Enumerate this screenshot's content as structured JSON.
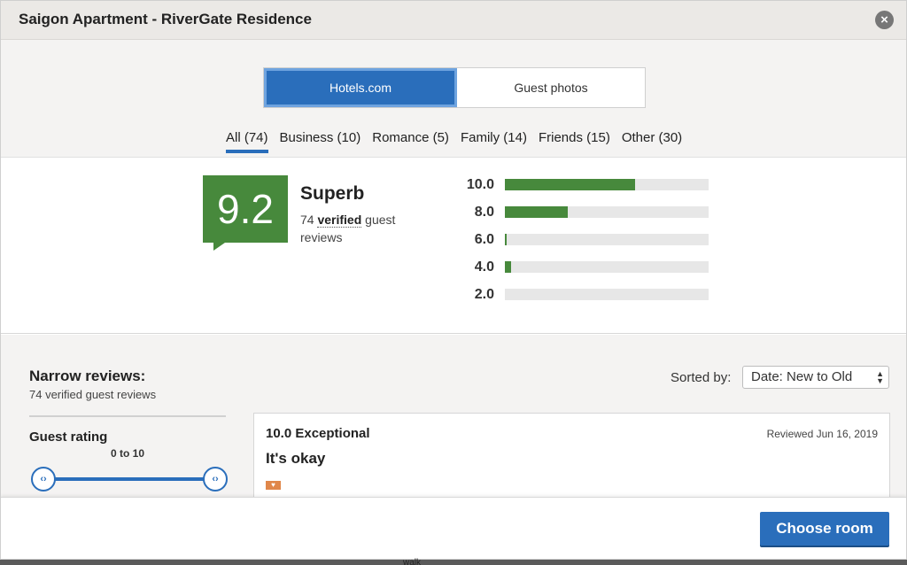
{
  "window": {
    "title": "Saigon Apartment - RiverGate Residence",
    "close_icon": "close-icon"
  },
  "source_toggle": [
    {
      "label": "Hotels.com",
      "active": true
    },
    {
      "label": "Guest photos",
      "active": false
    }
  ],
  "filter_tabs": [
    {
      "label": "All (74)",
      "active": true
    },
    {
      "label": "Business (10)",
      "active": false
    },
    {
      "label": "Romance (5)",
      "active": false
    },
    {
      "label": "Family (14)",
      "active": false
    },
    {
      "label": "Friends (15)",
      "active": false
    },
    {
      "label": "Other (30)",
      "active": false
    }
  ],
  "summary": {
    "score": "9.2",
    "rating_word": "Superb",
    "count_prefix": "74",
    "verified_word": "verified",
    "count_suffix": "guest reviews",
    "score_color": "#47893c"
  },
  "distribution": [
    {
      "label": "10.0",
      "fraction": 0.64
    },
    {
      "label": "8.0",
      "fraction": 0.31
    },
    {
      "label": "6.0",
      "fraction": 0.01
    },
    {
      "label": "4.0",
      "fraction": 0.03
    },
    {
      "label": "2.0",
      "fraction": 0
    }
  ],
  "narrow": {
    "title": "Narrow reviews:",
    "subtitle": "74 verified guest reviews",
    "guest_rating_label": "Guest rating",
    "range_text": "0 to 10",
    "slider_min": 0,
    "slider_max": 10
  },
  "sort": {
    "label": "Sorted by:",
    "selected": "Date: New to Old"
  },
  "review": {
    "score_text": "10.0 Exceptional",
    "date_text": "Reviewed Jun 16, 2019",
    "title": "It's okay",
    "tag_icon": "traveler-type-icon",
    "tag_color": "#e0874a"
  },
  "footer": {
    "choose_room_label": "Choose room"
  },
  "background_text": "walk",
  "colors": {
    "accent": "#2a6ebb",
    "positive": "#47893c",
    "tag": "#e0874a"
  }
}
